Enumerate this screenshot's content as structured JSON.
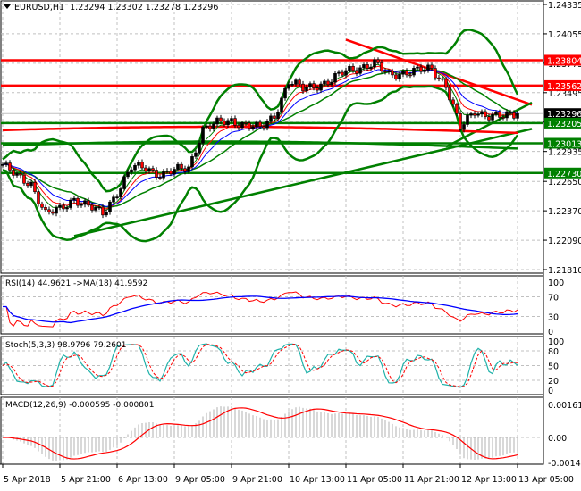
{
  "header": {
    "symbol": "EURUSD,H1",
    "open": "1.23294",
    "high": "1.23302",
    "low": "1.23278",
    "close": "1.23296"
  },
  "colors": {
    "up_candle": "#000000",
    "down_candle": "#ff0000",
    "support": "#008000",
    "resistance": "#ff0000",
    "bollinger": "#008000",
    "current_price_tag": "#000000"
  },
  "price_axis": {
    "ticks": [
      "1.24335",
      "1.24055",
      "1.23775",
      "1.23495",
      "1.23215",
      "1.22935",
      "1.22650",
      "1.22370",
      "1.22090",
      "1.21810"
    ]
  },
  "levels": [
    {
      "price": "1.23804",
      "color": "#ff0000"
    },
    {
      "price": "1.23562",
      "color": "#ff0000"
    },
    {
      "price": "1.23296",
      "color": "#000000"
    },
    {
      "price": "1.23205",
      "color": "#008000"
    },
    {
      "price": "1.23013",
      "color": "#008000"
    },
    {
      "price": "1.22730",
      "color": "#008000"
    }
  ],
  "time_axis": {
    "labels": [
      "5 Apr 2018",
      "5 Apr 21:00",
      "6 Apr 13:00",
      "9 Apr 05:00",
      "9 Apr 21:00",
      "10 Apr 13:00",
      "11 Apr 05:00",
      "11 Apr 21:00",
      "12 Apr 13:00",
      "13 Apr 05:00"
    ]
  },
  "rsi": {
    "label": "RSI(14) 44.9621  ->MA(18) 41.9592",
    "ticks": [
      "100",
      "70",
      "30",
      "0"
    ]
  },
  "stoch": {
    "label": "Stoch(5,3,3) 98.9796 79.2601",
    "ticks": [
      "100",
      "80",
      "50",
      "20",
      "0"
    ]
  },
  "macd": {
    "label": "MACD(12,26,9) -0.000595 -0.000801",
    "ticks": [
      "0.00161",
      "0.00",
      "-0.001436"
    ]
  },
  "chart_data": {
    "type": "candlestick",
    "symbol": "EURUSD",
    "timeframe": "H1",
    "ylim": [
      1.2181,
      1.24335
    ],
    "x": [
      "5 Apr 05:00",
      "5 Apr 09:00",
      "5 Apr 13:00",
      "5 Apr 17:00",
      "5 Apr 21:00",
      "6 Apr 01:00",
      "6 Apr 05:00",
      "6 Apr 09:00",
      "6 Apr 13:00",
      "6 Apr 17:00",
      "6 Apr 21:00",
      "9 Apr 01:00",
      "9 Apr 05:00",
      "9 Apr 09:00",
      "9 Apr 13:00",
      "9 Apr 17:00",
      "9 Apr 21:00",
      "10 Apr 01:00",
      "10 Apr 05:00",
      "10 Apr 09:00",
      "10 Apr 13:00",
      "10 Apr 17:00",
      "10 Apr 21:00",
      "11 Apr 01:00",
      "11 Apr 05:00",
      "11 Apr 09:00",
      "11 Apr 13:00",
      "11 Apr 17:00",
      "11 Apr 21:00",
      "12 Apr 01:00",
      "12 Apr 05:00",
      "12 Apr 09:00",
      "12 Apr 13:00",
      "12 Apr 17:00",
      "12 Apr 21:00",
      "13 Apr 01:00",
      "13 Apr 05:00"
    ],
    "close": [
      1.2281,
      1.2269,
      1.2263,
      1.2234,
      1.2238,
      1.2249,
      1.2241,
      1.2234,
      1.2255,
      1.2278,
      1.2278,
      1.2272,
      1.2275,
      1.2278,
      1.2315,
      1.232,
      1.2323,
      1.2319,
      1.2315,
      1.2328,
      1.236,
      1.2353,
      1.2357,
      1.2361,
      1.237,
      1.2374,
      1.2377,
      1.2366,
      1.2369,
      1.237,
      1.2372,
      1.2357,
      1.2315,
      1.2332,
      1.2328,
      1.2326,
      1.23296
    ],
    "trendlines": [
      {
        "color": "#ff0000",
        "from": [
          "11 Apr 05:00",
          1.24
        ],
        "to": [
          "13 Apr 09:00",
          1.2338
        ]
      },
      {
        "color": "#008000",
        "from": [
          "6 Apr 01:00",
          1.2213
        ],
        "to": [
          "13 Apr 09:00",
          1.2315
        ]
      },
      {
        "color": "#008000",
        "from": [
          "12 Apr 09:00",
          1.2298
        ],
        "to": [
          "13 Apr 09:00",
          1.234
        ]
      }
    ]
  }
}
